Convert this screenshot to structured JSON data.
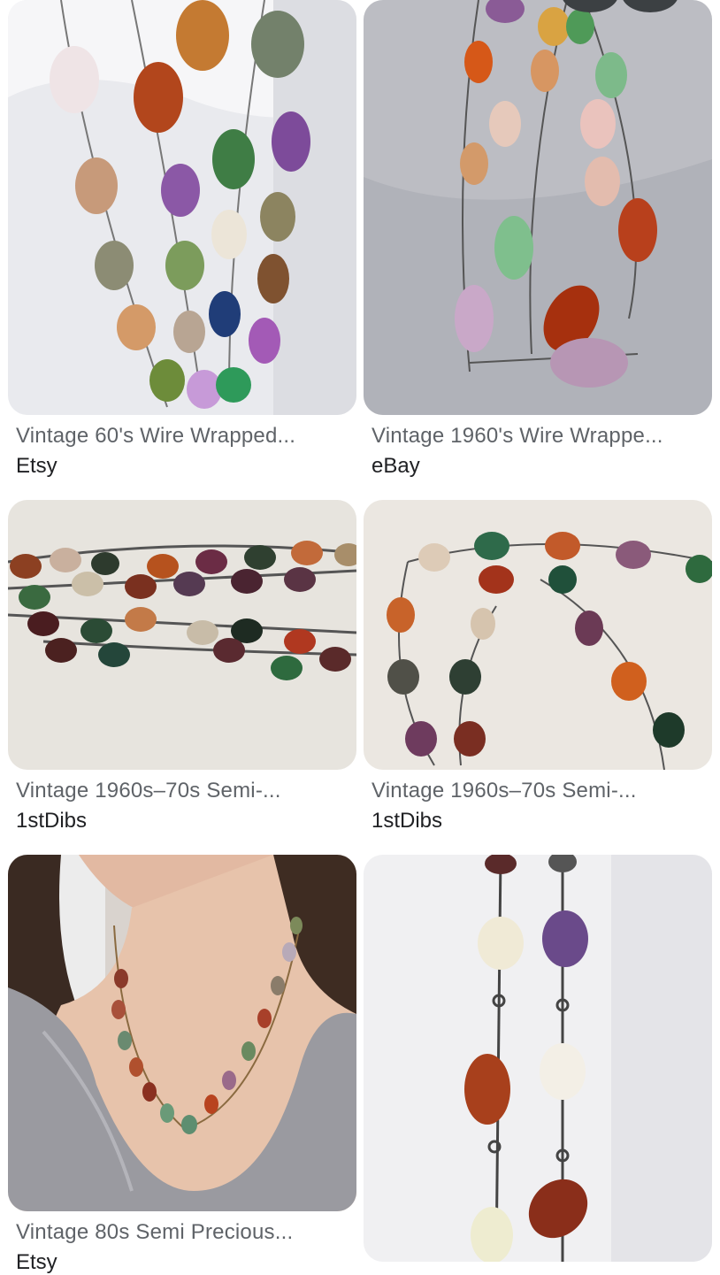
{
  "results": [
    {
      "title": "Vintage 60's Wire Wrapped...",
      "source": "Etsy",
      "image": "necklaces-on-white-bust"
    },
    {
      "title": "Vintage 1960's Wire Wrappe...",
      "source": "eBay",
      "image": "necklace-on-gray-fabric"
    },
    {
      "title": "Vintage 1960s–70s Semi-...",
      "source": "1stDibs",
      "image": "stone-chain-strands"
    },
    {
      "title": "Vintage 1960s–70s Semi-...",
      "source": "1stDibs",
      "image": "stone-chain-loop"
    },
    {
      "title": "Vintage 80s Semi Precious...",
      "source": "Etsy",
      "image": "necklace-worn-by-model"
    },
    {
      "title": "",
      "source": "",
      "image": "hanging-stone-strands"
    }
  ],
  "colors": {
    "title_text": "#5f6368",
    "source_text": "#202124",
    "background": "#ffffff"
  }
}
